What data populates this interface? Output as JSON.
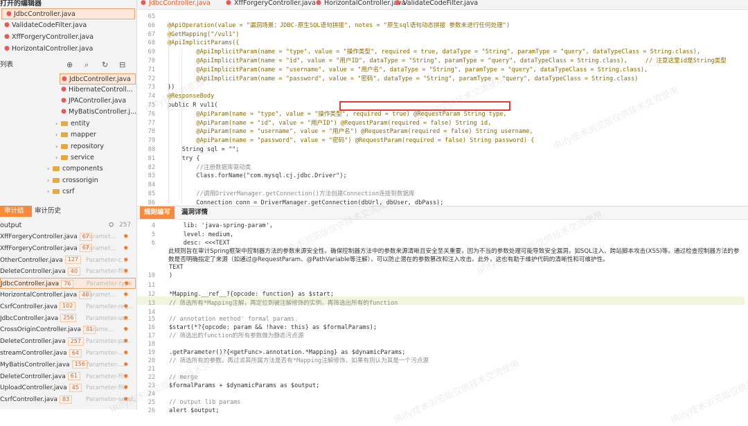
{
  "open_editors": {
    "title": "打开的编辑器",
    "files": [
      "JdbcController.java",
      "ValidateCodeFilter.java",
      "XffForgeryController.java",
      "HorizontalController.java"
    ]
  },
  "explorer": {
    "title": "列表",
    "files": [
      "JdbcController.java",
      "HibernateControll...",
      "JPAController.java",
      "MyBatisController.j..."
    ],
    "folders": [
      "entity",
      "mapper",
      "repository",
      "service",
      "components",
      "crossorigin",
      "csrf"
    ]
  },
  "result_tabs": [
    "审计结果",
    "审计历史"
  ],
  "output": {
    "title": "output",
    "count": "257"
  },
  "results": [
    {
      "file": "XffForgeryController.java",
      "n": "67",
      "type": "Paramet..."
    },
    {
      "file": "XffForgeryController.java",
      "n": "67",
      "type": "Paramet..."
    },
    {
      "file": "OtherController.java",
      "n": "127",
      "type": "Parameter-c..."
    },
    {
      "file": "DeleteController.java",
      "n": "40",
      "type": "Parameter-fil..."
    },
    {
      "file": "JdbcController.java",
      "n": "76",
      "type": "Parameter-type"
    },
    {
      "file": "HorizontalController.java",
      "n": "46",
      "type": "Paramet..."
    },
    {
      "file": "CsrfController.java",
      "n": "102",
      "type": "Parameter-req..."
    },
    {
      "file": "JdbcController.java",
      "n": "256",
      "type": "Parameter-us..."
    },
    {
      "file": "CrossOriginController.java",
      "n": "81",
      "type": "Parame..."
    },
    {
      "file": "DeleteController.java",
      "n": "257",
      "type": "Parameter-pa..."
    },
    {
      "file": "streamController.java",
      "n": "64",
      "type": "Parameter-..."
    },
    {
      "file": "MyBatisController.java",
      "n": "156",
      "type": "Parameter-..."
    },
    {
      "file": "DeleteController.java",
      "n": "61",
      "type": "Parameter-fil..."
    },
    {
      "file": "UploadController.java",
      "n": "45",
      "type": "Parameter-file"
    },
    {
      "file": "CsrfController.java",
      "n": "83",
      "type": "Parameter-sessi..."
    }
  ],
  "editor_tabs": [
    "JdbcController.java",
    "XffForgeryController.java",
    "HorizontalController.java",
    "ValidateCodeFilter.java"
  ],
  "code": [
    {
      "n": "65",
      "t": ""
    },
    {
      "n": "66",
      "t": "@ApiOperation(value = \"漏洞场景：JDBC-原生SQL语句拼接\", notes = \"原生sql语句动态拼接 参数未进行任何处理\")"
    },
    {
      "n": "67",
      "t": "@GetMapping(\"/vul1\")"
    },
    {
      "n": "68",
      "t": "@ApiImplicitParams({"
    },
    {
      "n": "69",
      "t": "        @ApiImplicitParam(name = \"type\", value = \"操作类型\", required = true, dataType = \"String\", paramType = \"query\", dataTypeClass = String.class),"
    },
    {
      "n": "70",
      "t": "        @ApiImplicitParam(name = \"id\", value = \"用户ID\", dataType = \"String\", paramType = \"query\", dataTypeClass = String.class),     // 注意这里id是String类型"
    },
    {
      "n": "71",
      "t": "        @ApiImplicitParam(name = \"username\", value = \"用户名\", dataType = \"String\", paramType = \"query\", dataTypeClass = String.class),"
    },
    {
      "n": "72",
      "t": "        @ApiImplicitParam(name = \"password\", value = \"密码\", dataType = \"String\", paramType = \"query\", dataTypeClass = String.class)"
    },
    {
      "n": "73",
      "t": "})"
    },
    {
      "n": "74",
      "t": "@ResponseBody"
    },
    {
      "n": "75",
      "t": "public R vul1("
    },
    {
      "n": "76",
      "t": "        @ApiParam(name = \"type\", value = \"操作类型\", required = true) @RequestParam String type,"
    },
    {
      "n": "77",
      "t": "        @ApiParam(name = \"id\", value = \"用户ID\") @RequestParam(required = false) String id,"
    },
    {
      "n": "78",
      "t": "        @ApiParam(name = \"username\", value = \"用户名\") @RequestParam(required = false) String username,"
    },
    {
      "n": "79",
      "t": "        @ApiParam(name = \"password\", value = \"密码\") @RequestParam(required = false) String password) {"
    },
    {
      "n": "80",
      "t": "    String sql = \"\";"
    },
    {
      "n": "81",
      "t": "    try {"
    },
    {
      "n": "82",
      "t": "        //注册数据库驱动类"
    },
    {
      "n": "83",
      "t": "        Class.forName(\"com.mysql.cj.jdbc.Driver\");"
    },
    {
      "n": "84",
      "t": ""
    },
    {
      "n": "85",
      "t": "        //调用DriverManager.getConnection()方法创建Connection连接到数据库"
    },
    {
      "n": "86",
      "t": "        Connection conn = DriverManager.getConnection(dbUrl, dbUser, dbPass);"
    }
  ],
  "bottom_tabs": [
    "规则编写",
    "漏洞详情"
  ],
  "rule": [
    {
      "n": "4",
      "t": "    lib: 'java-spring-param',"
    },
    {
      "n": "5",
      "t": "    level: medium,"
    },
    {
      "n": "6",
      "t": "    desc: <<<TEXT"
    }
  ],
  "rule_desc": "此规则旨在审计Spring框架中控制器方法的参数来源安全性。确保控制器方法中的参数来源清晰且安全至关重要，因为不当的参数处理可能导致安全漏洞，如SQL注入、跨站脚本攻击(XSS)等。通过检查控制器方法的参数是否明确指定了来源（如通过@RequestParam、@PathVariable等注解），可以防止潜在的参数篡改和注入攻击。此外，这也有助于维护代码的清晰性和可维护性。",
  "rule_rest": [
    {
      "n": "",
      "t": "TEXT"
    },
    {
      "n": "10",
      "t": ")"
    },
    {
      "n": "11",
      "t": ""
    },
    {
      "n": "12",
      "t": "*Mapping.__ref__?{opcode: function} as $start;"
    },
    {
      "n": "13",
      "t": "// 筛选所有*Mapping注解，再定位到被注解修饰的实例，再筛选出所有的function"
    },
    {
      "n": "14",
      "t": ""
    },
    {
      "n": "15",
      "t": "// annotation method' formal params."
    },
    {
      "n": "16",
      "t": "$start(*?{opcode: param && !have: this} as $formalParams);"
    },
    {
      "n": "17",
      "t": "// 筛选出的function的所有参数做为静态污点源"
    },
    {
      "n": "18",
      "t": ""
    },
    {
      "n": "19",
      "t": ".getParameter()?{<getFunc>.annotation.*Mapping} as $dynamicParams;"
    },
    {
      "n": "20",
      "t": "// 筛选所有的参数，再过滤其所属方法是否有*Mapping注解修饰，如果有则认为其是一个污点源"
    },
    {
      "n": "21",
      "t": ""
    },
    {
      "n": "22",
      "t": "// merge"
    },
    {
      "n": "23",
      "t": "$formalParams + $dynamicParams as $output;"
    },
    {
      "n": "24",
      "t": ""
    },
    {
      "n": "25",
      "t": "// output lib params"
    },
    {
      "n": "26",
      "t": "alert $output;"
    }
  ],
  "watermark": "IRify技术浏览版仅供技术交流使用"
}
